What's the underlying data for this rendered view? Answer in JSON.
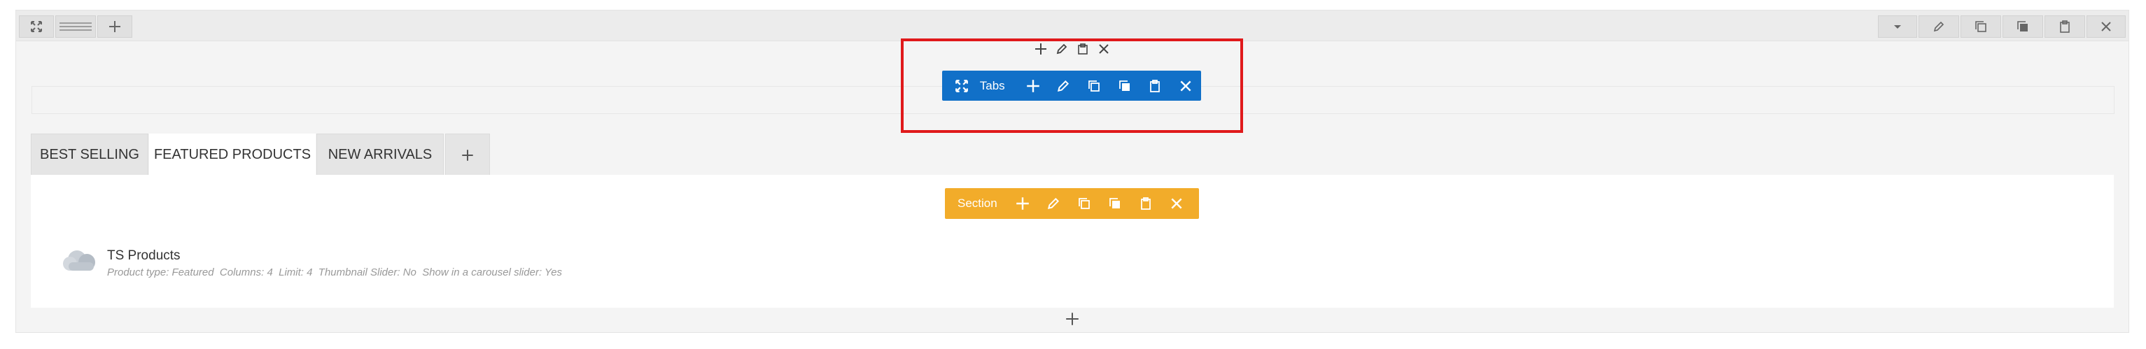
{
  "row_toolbar": {
    "left": [
      "expand-icon",
      "drag-handle-icon",
      "plus-icon"
    ],
    "right": [
      "chevron-down-icon",
      "pencil-icon",
      "copy-icon",
      "duplicate-icon",
      "clipboard-icon",
      "close-icon"
    ]
  },
  "element_toolbar": {
    "label": "Tabs",
    "color": "#1170c8",
    "highlight_color": "#e0191b"
  },
  "tabs": [
    {
      "label": "BEST SELLING",
      "active": false
    },
    {
      "label": "FEATURED PRODUCTS",
      "active": true
    },
    {
      "label": "NEW ARRIVALS",
      "active": false
    }
  ],
  "section_toolbar": {
    "label": "Section",
    "color": "#f2ac2a"
  },
  "product_widget": {
    "title": "TS Products",
    "description": "Product type: Featured  Columns: 4  Limit: 4  Thumbnail Slider: No  Show in a carousel slider: Yes"
  }
}
